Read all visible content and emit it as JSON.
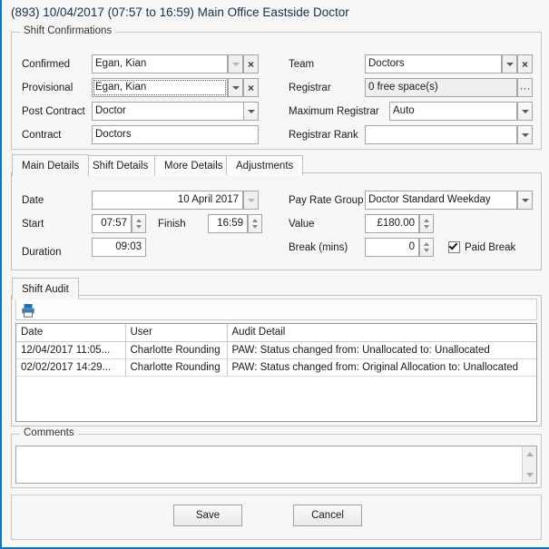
{
  "window": {
    "title": "(893) 10/04/2017 (07:57 to 16:59) Main Office Eastside Doctor",
    "border_color": "#1274c8",
    "background": "#f7f7f7"
  },
  "shift_confirmations": {
    "legend": "Shift Confirmations",
    "fields": {
      "confirmed": {
        "label": "Confirmed",
        "value": "Egan, Kian",
        "clear_glyph": "×"
      },
      "provisional": {
        "label": "Provisional",
        "value": "Egan, Kian",
        "clear_glyph": "×"
      },
      "post_contract": {
        "label": "Post Contract",
        "value": "Doctor"
      },
      "contract": {
        "label": "Contract",
        "value": "Doctors"
      },
      "team": {
        "label": "Team",
        "value": "Doctors",
        "clear_glyph": "×"
      },
      "registrar": {
        "label": "Registrar",
        "value": "0 free space(s)",
        "browse_glyph": "···"
      },
      "maximum_registrar": {
        "label": "Maximum Registrar",
        "value": "Auto"
      },
      "registrar_rank": {
        "label": "Registrar Rank",
        "value": ""
      }
    }
  },
  "details_tabs": {
    "tabs": [
      {
        "label": "Main Details",
        "active": true
      },
      {
        "label": "Shift Details",
        "active": false
      },
      {
        "label": "More Details",
        "active": false
      },
      {
        "label": "Adjustments",
        "active": false
      }
    ],
    "main_details": {
      "date": {
        "label": "Date",
        "value": "10 April 2017"
      },
      "start": {
        "label": "Start",
        "value": "07:57"
      },
      "finish": {
        "label": "Finish",
        "value": "16:59"
      },
      "duration": {
        "label": "Duration",
        "value": "09:03"
      },
      "pay_rate_group": {
        "label": "Pay Rate Group",
        "value": "Doctor Standard Weekday"
      },
      "value": {
        "label": "Value",
        "value": "£180.00"
      },
      "break_mins": {
        "label": "Break (mins)",
        "value": "0"
      },
      "paid_break": {
        "label": "Paid Break",
        "checked": true
      }
    }
  },
  "shift_audit": {
    "tab_label": "Shift Audit",
    "toolbar": {
      "print_tooltip": "Print"
    },
    "columns": [
      "Date",
      "User",
      "Audit Detail"
    ],
    "rows": [
      {
        "date": "12/04/2017 11:05...",
        "user": "Charlotte Rounding",
        "detail": "PAW: Status changed from: Unallocated to: Unallocated"
      },
      {
        "date": "02/02/2017 14:29...",
        "user": "Charlotte Rounding",
        "detail": "PAW: Status changed from: Original Allocation to: Unallocated"
      }
    ]
  },
  "comments": {
    "legend": "Comments",
    "value": "",
    "placeholder": ""
  },
  "actions": {
    "save_label": "Save",
    "cancel_label": "Cancel"
  }
}
